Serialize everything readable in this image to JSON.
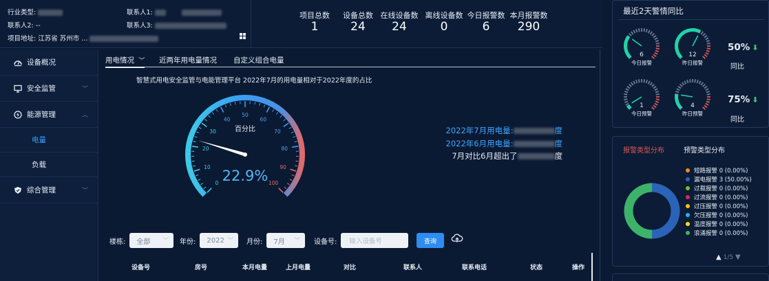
{
  "info": {
    "industry_label": "行业类型:",
    "contact1_label": "联系人1:",
    "contact2_label": "联系人2:",
    "contact2_value": "--",
    "contact3_label": "联系人3:",
    "address_label": "项目地址:",
    "address_value": "江苏省 苏州市 ..."
  },
  "stats": [
    {
      "label": "项目总数",
      "value": "1"
    },
    {
      "label": "设备总数",
      "value": "24"
    },
    {
      "label": "在线设备数",
      "value": "24"
    },
    {
      "label": "离线设备数",
      "value": "0"
    },
    {
      "label": "今日报警数",
      "value": "6"
    },
    {
      "label": "本月报警数",
      "value": "290"
    }
  ],
  "sidebar": {
    "items": [
      {
        "label": "设备概况",
        "icon": "dashboard-icon"
      },
      {
        "label": "安全监管",
        "icon": "monitor-icon"
      },
      {
        "label": "能源管理",
        "icon": "energy-icon"
      },
      {
        "label": "电量",
        "icon": ""
      },
      {
        "label": "负载",
        "icon": ""
      },
      {
        "label": "综合管理",
        "icon": "shield-icon"
      }
    ]
  },
  "tabs": [
    "用电情况",
    "近两年用电量情况",
    "自定义组合电量"
  ],
  "subtitle": "智慧式用电安全监管与电能管理平台 2022年7月的用电量相对于2022年度的占比",
  "gauge": {
    "title": "百分比",
    "value_text": "22.9%",
    "value": 22.9,
    "ticks": [
      "0",
      "10",
      "20",
      "30",
      "40",
      "50",
      "60",
      "70",
      "80",
      "90",
      "100"
    ]
  },
  "compare": {
    "line1": "2022年7月用电量:",
    "line1_suffix": "度",
    "line2": "2022年6月用电量:",
    "line2_suffix": "度",
    "line3": "7月对比6月超出了",
    "line3_suffix": "度"
  },
  "filters": {
    "building_label": "楼栋:",
    "building_value": "全部",
    "year_label": "年份:",
    "year_value": "2022",
    "month_label": "月份:",
    "month_value": "7月",
    "device_label": "设备号:",
    "device_placeholder": "输入设备号",
    "query_label": "查询"
  },
  "table_headers": [
    "设备号",
    "房号",
    "本月电量",
    "上月电量",
    "对比",
    "联系人",
    "联系电话",
    "状态",
    "操作"
  ],
  "right1": {
    "title": "最近2天警情同比",
    "rows": [
      {
        "g1_value": "6",
        "g1_label": "今日报警",
        "g2_value": "12",
        "g2_label": "昨日报警",
        "pct": "50%",
        "trend": "同比"
      },
      {
        "g1_value": "1",
        "g1_label": "今日预警",
        "g2_value": "4",
        "g2_label": "昨日预警",
        "pct": "75%",
        "trend": "同比"
      }
    ]
  },
  "right2": {
    "tab_active": "报警类型分布",
    "tab_other": "预警类型分布",
    "legend": [
      {
        "label": "短路报警 0 (0.00%)",
        "color": "#f08c2e"
      },
      {
        "label": "漏电报警 3 (50.00%)",
        "color": "#2b63b8"
      },
      {
        "label": "过载报警 0 (0.00%)",
        "color": "#7cc02b"
      },
      {
        "label": "过流报警 0 (0.00%)",
        "color": "#d8295e"
      },
      {
        "label": "过压报警 0 (0.00%)",
        "color": "#f5c217"
      },
      {
        "label": "欠压报警 0 (0.00%)",
        "color": "#2ab0e8"
      },
      {
        "label": "温度报警 0 (0.00%)",
        "color": "#f0e020"
      },
      {
        "label": "浪涌报警 0 (0.00%)",
        "color": "#3db36a"
      }
    ],
    "donut": [
      {
        "name": "漏电报警",
        "value": 3,
        "color": "#2b63b8"
      },
      {
        "name": "浪涌报警",
        "value": 3,
        "color": "#3db36a"
      }
    ],
    "pager": "1/5"
  },
  "colors": {
    "bg": "#0b1a33",
    "accent": "#3b9cff",
    "alarm_red": "#e05555",
    "teal": "#1fd3a8"
  }
}
